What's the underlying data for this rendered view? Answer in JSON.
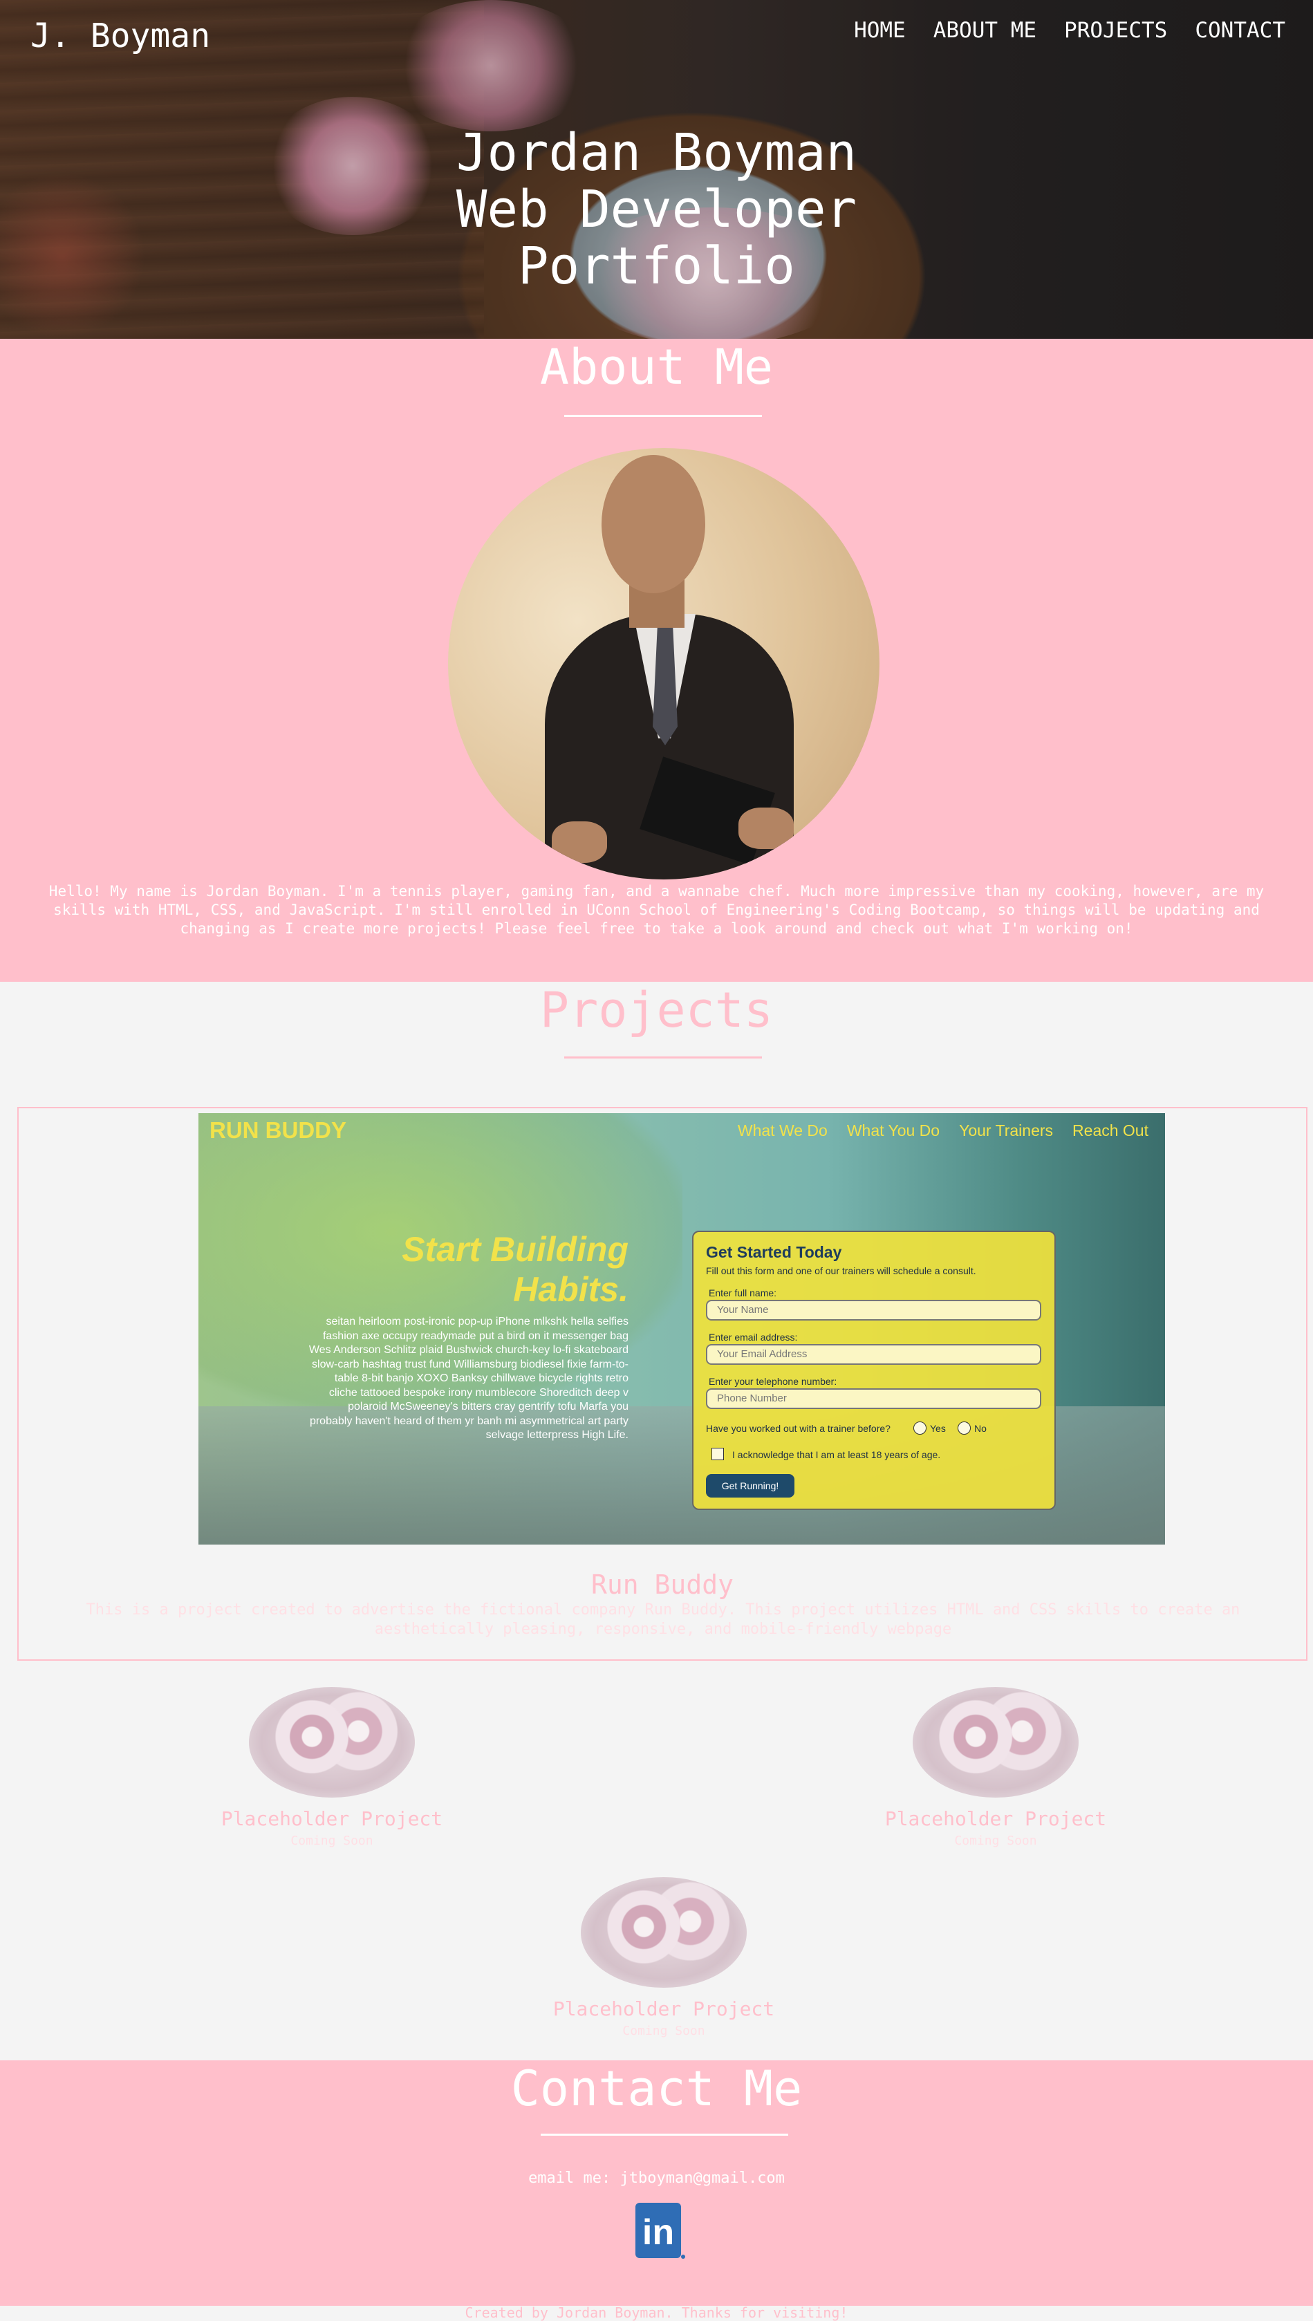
{
  "header": {
    "logo": "J. Boyman",
    "nav": [
      "HOME",
      "ABOUT ME",
      "PROJECTS",
      "CONTACT"
    ],
    "hero_title_lines": [
      "Jordan Boyman",
      "Web Developer",
      "Portfolio"
    ]
  },
  "about": {
    "title": "About Me",
    "bio": "Hello! My name is Jordan Boyman. I'm a tennis player, gaming fan, and a wannabe chef. Much more impressive than my cooking, however, are my skills with HTML, CSS, and JavaScript. I'm still enrolled in UConn School of Engineering's Coding Bootcamp, so things will be updating and changing as I create more projects! Please feel free to take a look around and check out what I'm working on!"
  },
  "projects": {
    "title": "Projects",
    "featured": {
      "name": "Run Buddy",
      "description": "This is a project created to advertise the fictional company Run Buddy. This project utilizes HTML and CSS skills to create an aesthetically pleasing, responsive, and mobile-friendly webpage",
      "screenshot": {
        "logo": "RUN BUDDY",
        "nav": [
          "What We Do",
          "What You Do",
          "Your Trainers",
          "Reach Out"
        ],
        "headline_lines": [
          "Start Building",
          "Habits."
        ],
        "copy": "seitan heirloom post-ironic pop-up iPhone mlkshk hella selfies fashion axe occupy readymade put a bird on it messenger bag Wes Anderson Schlitz plaid Bushwick church-key lo-fi skateboard slow-carb hashtag trust fund Williamsburg biodiesel fixie farm-to-table 8-bit banjo XOXO Banksy chillwave bicycle rights retro cliche tattooed bespoke irony mumblecore Shoreditch deep v polaroid McSweeney's bitters cray gentrify tofu Marfa you probably haven't heard of them yr banh mi asymmetrical art party selvage letterpress High Life.",
        "form": {
          "title": "Get Started Today",
          "subtitle": "Fill out this form and one of our trainers will schedule a consult.",
          "name_label": "Enter full name:",
          "name_placeholder": "Your Name",
          "email_label": "Enter email address:",
          "email_placeholder": "Your Email Address",
          "phone_label": "Enter your telephone number:",
          "phone_placeholder": "Phone Number",
          "question": "Have you worked out with a trainer before?",
          "yes": "Yes",
          "no": "No",
          "ack": "I acknowledge that I am at least 18 years of age.",
          "button": "Get Running!"
        }
      }
    },
    "placeholders": [
      {
        "name": "Placeholder Project",
        "subtitle": "Coming Soon"
      },
      {
        "name": "Placeholder Project",
        "subtitle": "Coming Soon"
      },
      {
        "name": "Placeholder Project",
        "subtitle": "Coming Soon"
      }
    ]
  },
  "contact": {
    "title": "Contact Me",
    "email_text": "email me: jtboyman@gmail.com",
    "linkedin_glyph": "in",
    "linkedin_icon": "linkedin-icon"
  },
  "footer": {
    "text": "Created by Jordan Boyman. Thanks for visiting!"
  },
  "colors": {
    "accent_pink": "#ffbfcb",
    "page_bg": "#f4f4f4",
    "runbuddy_yellow": "#f2e24a",
    "linkedin_blue": "#2f6db5"
  }
}
